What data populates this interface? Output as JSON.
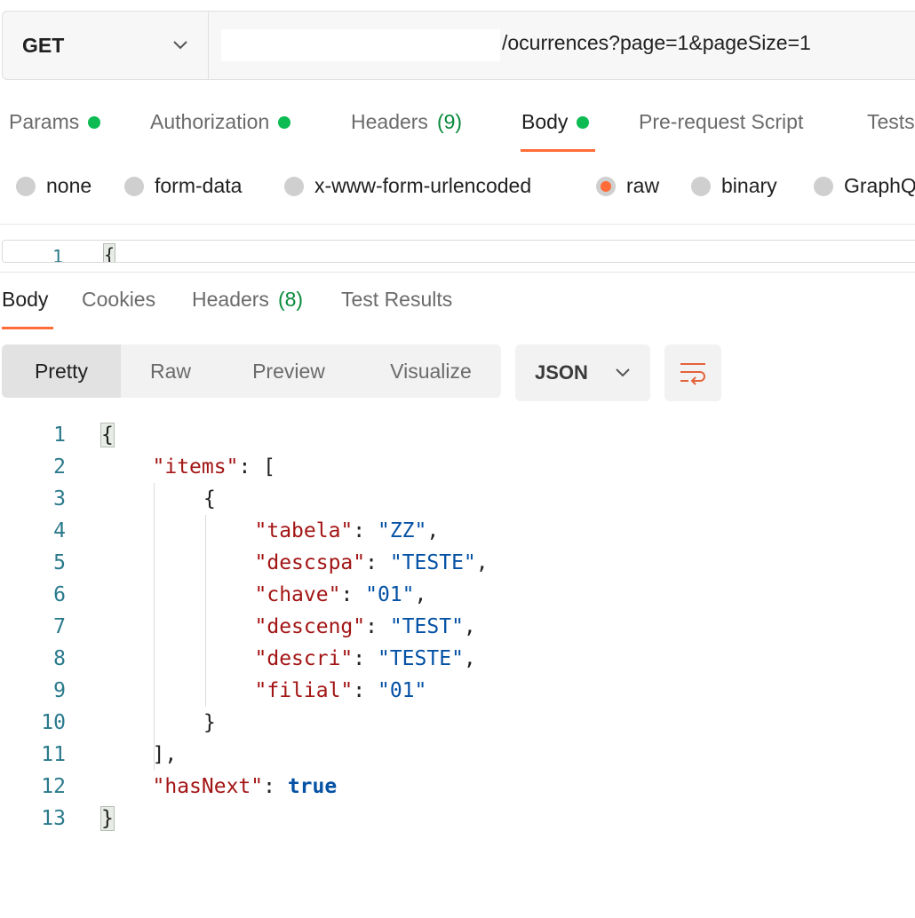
{
  "request": {
    "method": "GET",
    "url_suffix": "/ocurrences?page=1&pageSize=1"
  },
  "request_tabs": [
    {
      "label": "Params",
      "dot": true
    },
    {
      "label": "Authorization",
      "dot": true
    },
    {
      "label": "Headers",
      "count": "(9)"
    },
    {
      "label": "Body",
      "dot": true,
      "active": true
    },
    {
      "label": "Pre-request Script"
    },
    {
      "label": "Tests"
    }
  ],
  "body_types": [
    {
      "label": "none"
    },
    {
      "label": "form-data"
    },
    {
      "label": "x-www-form-urlencoded"
    },
    {
      "label": "raw",
      "selected": true
    },
    {
      "label": "binary"
    },
    {
      "label": "GraphQL"
    }
  ],
  "request_editor": {
    "line": "1",
    "text": "{"
  },
  "response_tabs": [
    {
      "label": "Body",
      "active": true
    },
    {
      "label": "Cookies"
    },
    {
      "label": "Headers",
      "count": "(8)"
    },
    {
      "label": "Test Results"
    }
  ],
  "view_modes": [
    "Pretty",
    "Raw",
    "Preview",
    "Visualize"
  ],
  "active_view": "Pretty",
  "format": "JSON",
  "code_lines": [
    {
      "n": "1",
      "indent": 0,
      "tokens": [
        {
          "t": "{",
          "c": "brk"
        }
      ]
    },
    {
      "n": "2",
      "indent": 1,
      "tokens": [
        {
          "t": "\"items\"",
          "c": "k"
        },
        {
          "t": ": ["
        }
      ]
    },
    {
      "n": "3",
      "indent": 2,
      "tokens": [
        {
          "t": "{"
        }
      ]
    },
    {
      "n": "4",
      "indent": 3,
      "tokens": [
        {
          "t": "\"tabela\"",
          "c": "k"
        },
        {
          "t": ": "
        },
        {
          "t": "\"ZZ\"",
          "c": "s"
        },
        {
          "t": ","
        }
      ]
    },
    {
      "n": "5",
      "indent": 3,
      "tokens": [
        {
          "t": "\"descspa\"",
          "c": "k"
        },
        {
          "t": ": "
        },
        {
          "t": "\"TESTE\"",
          "c": "s"
        },
        {
          "t": ","
        }
      ]
    },
    {
      "n": "6",
      "indent": 3,
      "tokens": [
        {
          "t": "\"chave\"",
          "c": "k"
        },
        {
          "t": ": "
        },
        {
          "t": "\"01\"",
          "c": "s"
        },
        {
          "t": ","
        }
      ]
    },
    {
      "n": "7",
      "indent": 3,
      "tokens": [
        {
          "t": "\"desceng\"",
          "c": "k"
        },
        {
          "t": ": "
        },
        {
          "t": "\"TEST\"",
          "c": "s"
        },
        {
          "t": ","
        }
      ]
    },
    {
      "n": "8",
      "indent": 3,
      "tokens": [
        {
          "t": "\"descri\"",
          "c": "k"
        },
        {
          "t": ": "
        },
        {
          "t": "\"TESTE\"",
          "c": "s"
        },
        {
          "t": ","
        }
      ]
    },
    {
      "n": "9",
      "indent": 3,
      "tokens": [
        {
          "t": "\"filial\"",
          "c": "k"
        },
        {
          "t": ": "
        },
        {
          "t": "\"01\"",
          "c": "s"
        }
      ]
    },
    {
      "n": "10",
      "indent": 2,
      "tokens": [
        {
          "t": "}"
        }
      ]
    },
    {
      "n": "11",
      "indent": 1,
      "tokens": [
        {
          "t": "],"
        }
      ]
    },
    {
      "n": "12",
      "indent": 1,
      "tokens": [
        {
          "t": "\"hasNext\"",
          "c": "k"
        },
        {
          "t": ": "
        },
        {
          "t": "true",
          "c": "b"
        }
      ]
    },
    {
      "n": "13",
      "indent": 0,
      "tokens": [
        {
          "t": "}",
          "c": "brk"
        }
      ]
    }
  ],
  "icons": {
    "method_dropdown": "chevron-down-icon",
    "format_dropdown": "chevron-down-icon",
    "wrap": "wrap-lines-icon"
  },
  "colors": {
    "accent": "#ff6c37",
    "status_dot": "#0cbb52",
    "count": "#0a8a3c",
    "key": "#a31515",
    "string": "#0451a5"
  }
}
